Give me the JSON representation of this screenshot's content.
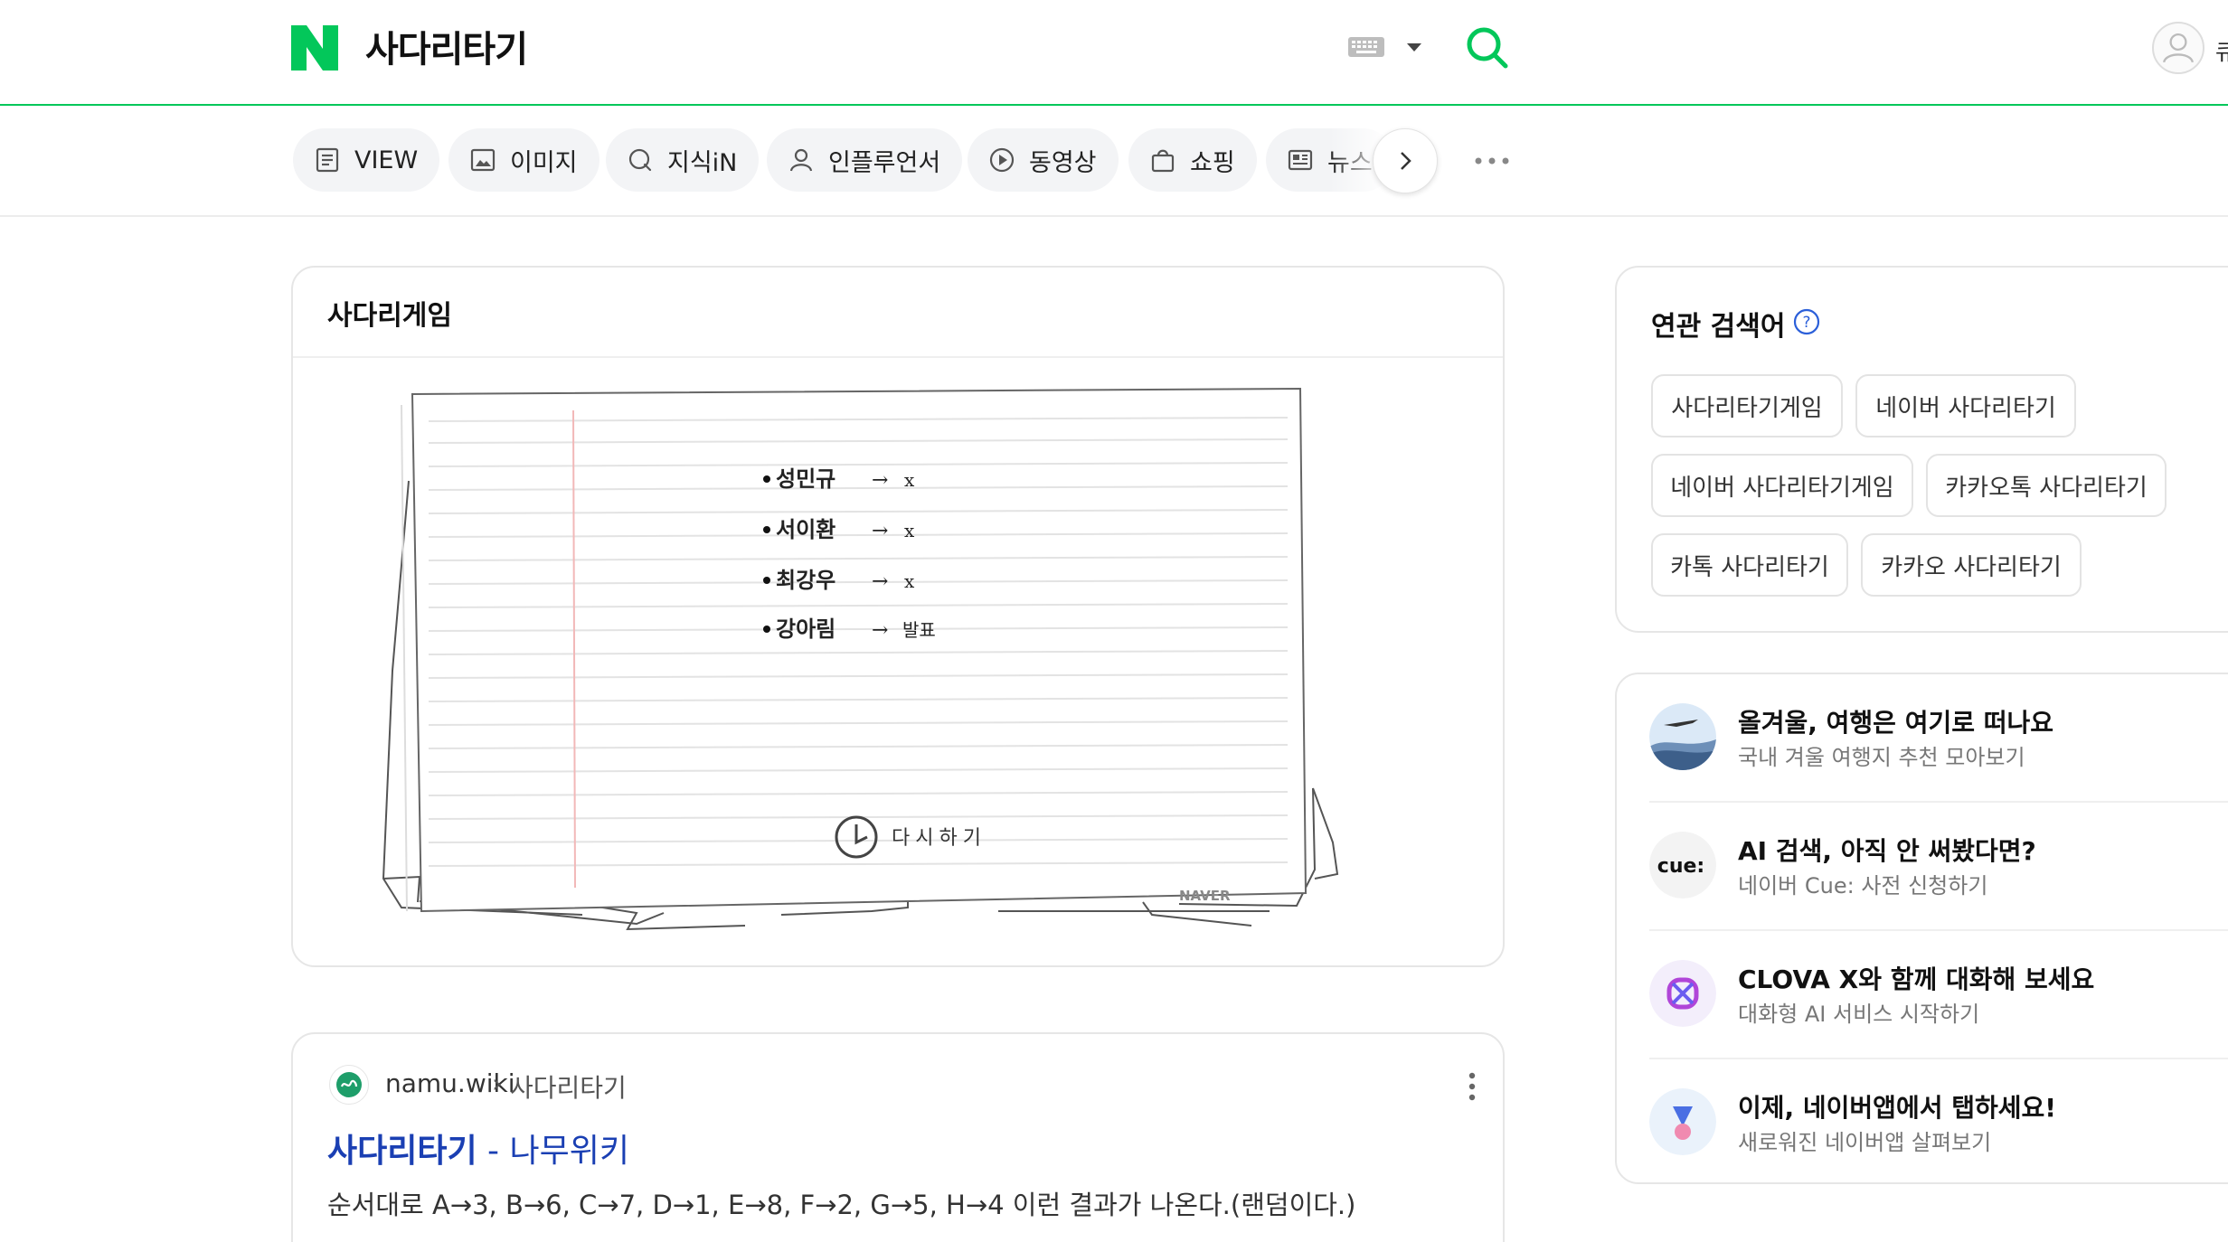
{
  "header": {
    "query": "사다리타기",
    "user_initial": "큐"
  },
  "tabs": [
    {
      "label": "VIEW",
      "icon": "view-icon"
    },
    {
      "label": "이미지",
      "icon": "image-icon"
    },
    {
      "label": "지식iN",
      "icon": "kin-icon"
    },
    {
      "label": "인플루언서",
      "icon": "person-icon"
    },
    {
      "label": "동영상",
      "icon": "play-icon"
    },
    {
      "label": "쇼핑",
      "icon": "bag-icon"
    },
    {
      "label": "뉴스",
      "icon": "news-icon"
    }
  ],
  "game_card": {
    "title": "사다리게임",
    "entries": [
      {
        "name": "성민규",
        "result": "x"
      },
      {
        "name": "서이환",
        "result": "x"
      },
      {
        "name": "최강우",
        "result": "x"
      },
      {
        "name": "강아림",
        "result": "발표"
      }
    ],
    "replay_label": "다시하기",
    "watermark": "NAVER"
  },
  "result": {
    "site": "namu.wiki",
    "separator": "›",
    "path": "사다리타기",
    "title_main": "사다리타기",
    "title_rest": " - 나무위키",
    "snippet": "순서대로 A→3, B→6, C→7, D→1, E→8, F→2, G→5, H→4 이런 결과가 나온다.(랜덤이다.)"
  },
  "related": {
    "title": "연관 검색어",
    "items": [
      "사다리타기게임",
      "네이버 사다리타기",
      "네이버 사다리타기게임",
      "카카오톡 사다리타기",
      "카톡 사다리타기",
      "카카오 사다리타기"
    ]
  },
  "promos": [
    {
      "title": "올겨울, 여행은 여기로 떠나요",
      "subtitle": "국내 겨울 여행지 추천 모아보기"
    },
    {
      "title": "AI 검색, 아직 안 써봤다면?",
      "subtitle": "네이버 Cue: 사전 신청하기",
      "icon_text": "cue:"
    },
    {
      "title": "CLOVA X와 함께 대화해 보세요",
      "subtitle": "대화형 AI 서비스 시작하기"
    },
    {
      "title": "이제, 네이버앱에서 탭하세요!",
      "subtitle": "새로워진 네이버앱 살펴보기"
    }
  ],
  "colors": {
    "brand_green": "#03c75a",
    "link_blue": "#1a3fb3"
  }
}
